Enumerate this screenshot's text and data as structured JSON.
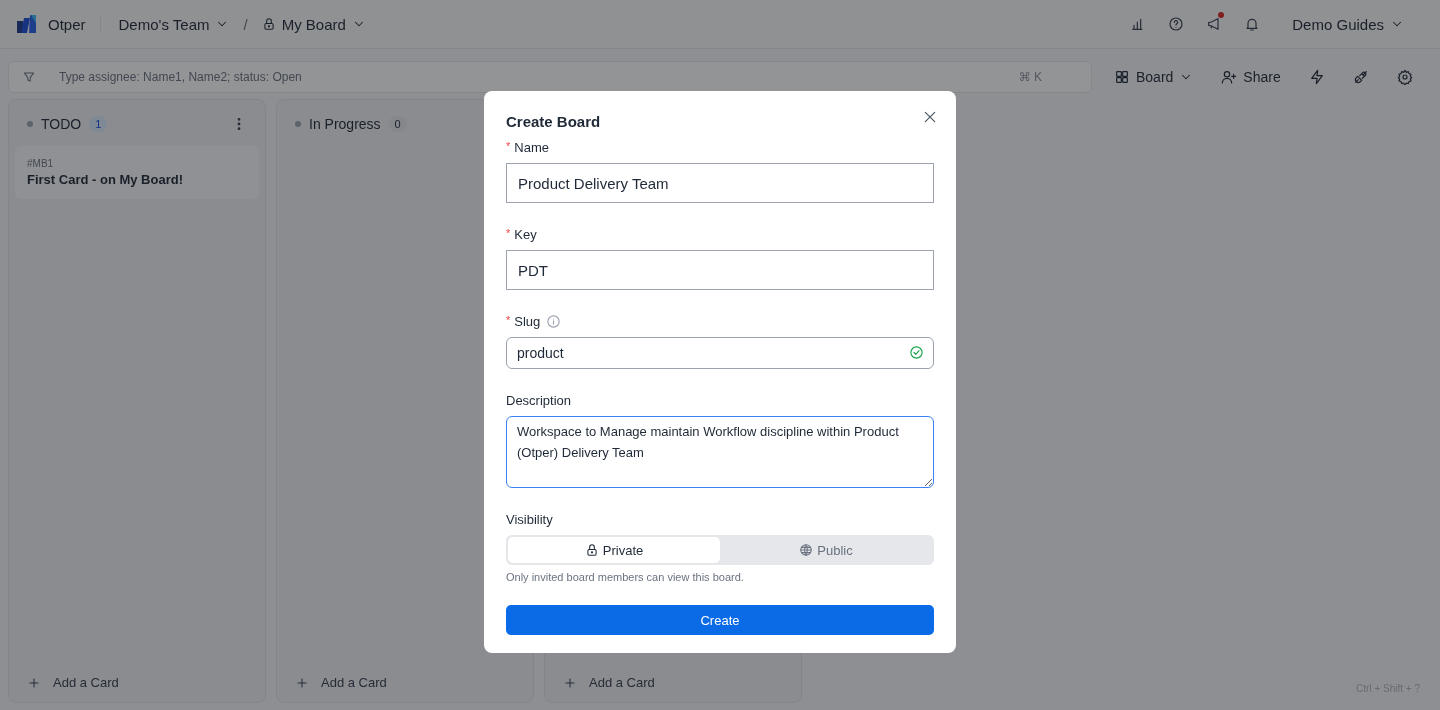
{
  "topbar": {
    "app_name": "Otper",
    "team": "Demo's Team",
    "separator": "/",
    "board": "My Board",
    "notification_dot": true,
    "user_menu": "Demo Guides"
  },
  "filter": {
    "placeholder": "Type assignee: Name1, Name2; status: Open",
    "shortcut": "⌘ K"
  },
  "toolbar": {
    "view": "Board",
    "share": "Share"
  },
  "columns": [
    {
      "name": "TODO",
      "count": "1",
      "has_menu": true,
      "cards": [
        {
          "key": "#MB1",
          "title": "First Card - on My Board!"
        }
      ],
      "add_label": "Add a Card"
    },
    {
      "name": "In Progress",
      "count": "0",
      "has_menu": false,
      "add_label": "Add a Card"
    },
    {
      "add_label": "Add a Card"
    }
  ],
  "shortcut_hint": "Ctrl + Shift + ?",
  "dialog": {
    "title": "Create Board",
    "fields": [
      {
        "kind": "input",
        "label": "Name",
        "required_mark": "*",
        "value": "Product Delivery Team"
      },
      {
        "kind": "input",
        "label": "Key",
        "required_mark": "*",
        "value": "PDT"
      },
      {
        "kind": "slug",
        "label": "Slug",
        "required_mark": "*",
        "info": true,
        "value": "product",
        "valid": true
      },
      {
        "kind": "textarea",
        "label": "Description",
        "value": "Workspace to Manage maintain Workflow discipline within Product (Otper) Delivery Team"
      }
    ],
    "visibility": {
      "label": "Visibility",
      "options": [
        {
          "label": "Private",
          "selected": true
        },
        {
          "label": "Public",
          "selected": false
        }
      ],
      "hint": "Only invited board members can view this board."
    },
    "submit": "Create"
  }
}
